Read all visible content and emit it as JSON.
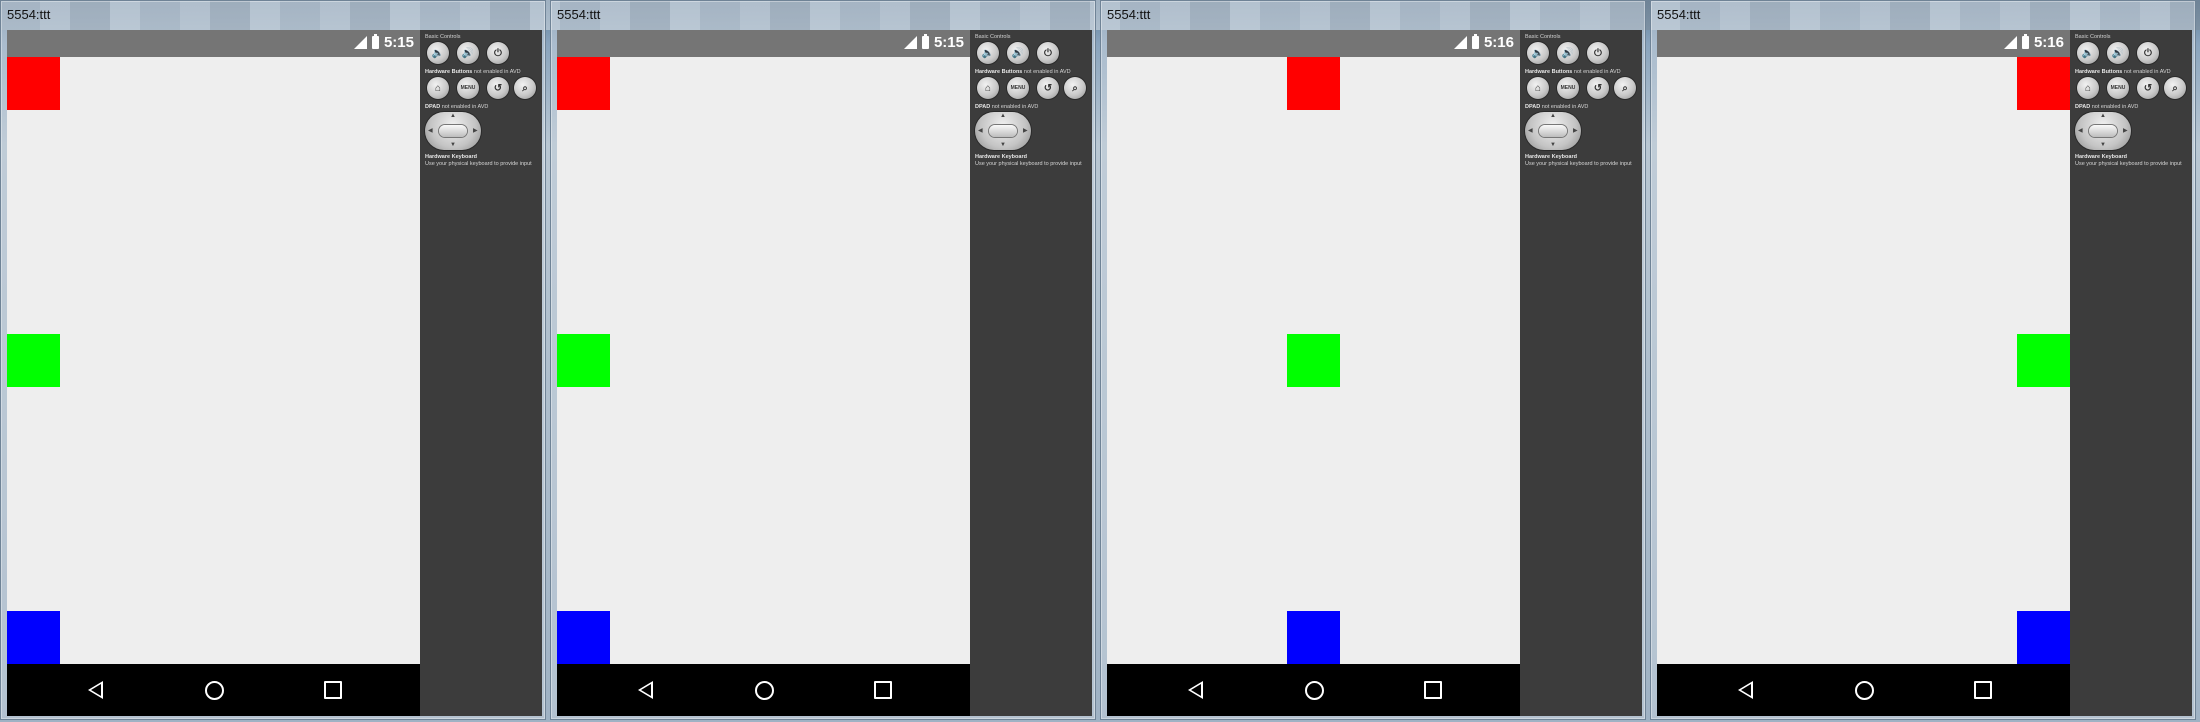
{
  "panels": [
    {
      "window_title": "5554:ttt",
      "clock": "5:15",
      "squares": [
        {
          "name": "red-square",
          "color": "#ff0000",
          "position": "left",
          "row": "top"
        },
        {
          "name": "green-square",
          "color": "#00ff00",
          "position": "left",
          "row": "middle"
        },
        {
          "name": "blue-square",
          "color": "#0000ff",
          "position": "left",
          "row": "bottom"
        }
      ]
    },
    {
      "window_title": "5554:ttt",
      "clock": "5:15",
      "squares": [
        {
          "name": "red-square",
          "color": "#ff0000",
          "position": "left",
          "row": "top"
        },
        {
          "name": "green-square",
          "color": "#00ff00",
          "position": "left",
          "row": "middle"
        },
        {
          "name": "blue-square",
          "color": "#0000ff",
          "position": "left",
          "row": "bottom"
        }
      ]
    },
    {
      "window_title": "5554:ttt",
      "clock": "5:16",
      "squares": [
        {
          "name": "red-square",
          "color": "#ff0000",
          "position": "center",
          "row": "top"
        },
        {
          "name": "green-square",
          "color": "#00ff00",
          "position": "center",
          "row": "middle"
        },
        {
          "name": "blue-square",
          "color": "#0000ff",
          "position": "center",
          "row": "bottom"
        }
      ]
    },
    {
      "window_title": "5554:ttt",
      "clock": "5:16",
      "squares": [
        {
          "name": "red-square",
          "color": "#ff0000",
          "position": "right",
          "row": "top"
        },
        {
          "name": "green-square",
          "color": "#00ff00",
          "position": "right",
          "row": "middle"
        },
        {
          "name": "blue-square",
          "color": "#0000ff",
          "position": "right",
          "row": "bottom"
        }
      ]
    }
  ],
  "controls": {
    "basic_controls": "Basic Controls",
    "hardware_buttons": "Hardware Buttons",
    "hardware_buttons_note": "not enabled in AVD",
    "menu_label": "MENU",
    "dpad": "DPAD",
    "dpad_note": "not enabled in AVD",
    "hw_keyboard": "Hardware Keyboard",
    "hw_keyboard_note": "Use your physical keyboard to provide input"
  },
  "icons": {
    "status": [
      "signal-icon",
      "battery-icon"
    ],
    "controls_row1": [
      "volume-down-icon",
      "volume-up-icon",
      "power-icon"
    ],
    "controls_row2": [
      "home-icon",
      "menu-icon",
      "back-icon",
      "search-icon"
    ],
    "nav": [
      "nav-back-icon",
      "nav-home-icon",
      "nav-recents-icon"
    ]
  }
}
